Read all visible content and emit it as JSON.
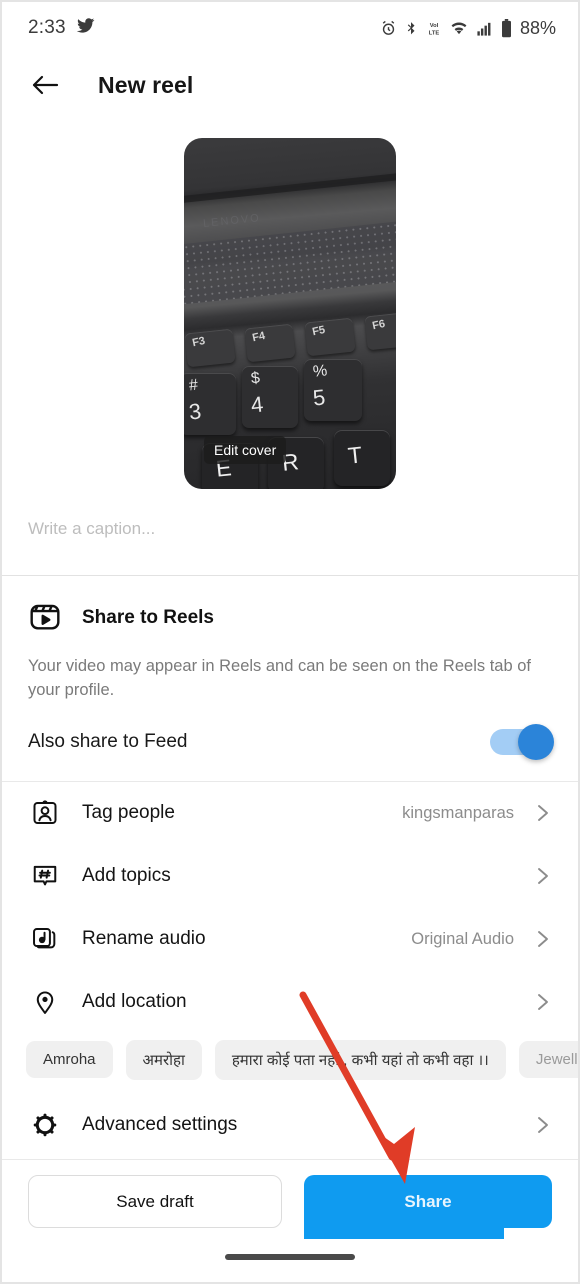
{
  "status_bar": {
    "time": "2:33",
    "app_icon": "twitter-bird-icon",
    "icons": [
      "alarm-icon",
      "bluetooth-icon",
      "volte-icon",
      "wifi-icon",
      "cellular-signal-icon",
      "battery-icon"
    ],
    "battery_percent": "88%"
  },
  "header": {
    "back_icon": "back-arrow-icon",
    "title": "New reel"
  },
  "media": {
    "edit_cover_label": "Edit cover",
    "keys": {
      "f3": "F3",
      "f4": "F4",
      "f5": "F5",
      "f6": "F6",
      "three_sym": "#",
      "three_num": "3",
      "four_sym": "$",
      "four_num": "4",
      "five_sym": "%",
      "five_num": "5",
      "e": "E",
      "r": "R",
      "t": "T"
    },
    "brand": "LENOVO"
  },
  "caption": {
    "placeholder": "Write a caption..."
  },
  "reels": {
    "icon": "reels-icon",
    "title": "Share to Reels",
    "description": "Your video may appear in Reels and can be seen on the Reels tab of your profile.",
    "feed_label": "Also share to Feed",
    "feed_toggle_state": "on",
    "toggle_color": "#2b84d9"
  },
  "options": [
    {
      "icon": "tag-people-icon",
      "label": "Tag people",
      "value": "kingsmanparas"
    },
    {
      "icon": "hashtag-icon",
      "label": "Add topics",
      "value": ""
    },
    {
      "icon": "audio-note-icon",
      "label": "Rename audio",
      "value": "Original Audio"
    },
    {
      "icon": "location-pin-icon",
      "label": "Add location",
      "value": ""
    }
  ],
  "location_chips": [
    "Amroha",
    "अमरोहा",
    "हमारा कोई पता नहीं , कभी यहां तो कभी वहा ।।",
    "Jewelle"
  ],
  "advanced": {
    "icon": "gear-icon",
    "label": "Advanced settings"
  },
  "footer": {
    "save_draft_label": "Save draft",
    "share_label": "Share",
    "share_color": "#0f9bf0"
  },
  "annotation": {
    "type": "arrow",
    "color": "#e03c27",
    "points_to": "share-button"
  }
}
